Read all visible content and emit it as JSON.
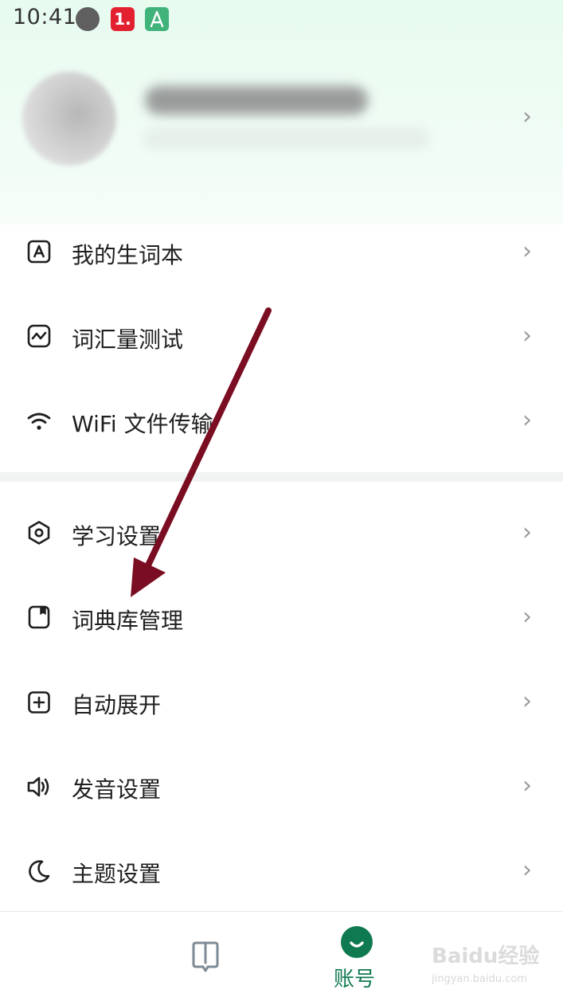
{
  "status_bar": {
    "time": "10:41",
    "badge_text": "1.",
    "icons": [
      "circle-icon",
      "badge-icon",
      "app-icon"
    ]
  },
  "profile": {
    "name": "",
    "chevron": "›"
  },
  "menu": {
    "group1": [
      {
        "label": "我的生词本",
        "icon": "wordbook-icon"
      },
      {
        "label": "词汇量测试",
        "icon": "chart-icon"
      },
      {
        "label": "WiFi 文件传输",
        "icon": "wifi-icon"
      }
    ],
    "group2": [
      {
        "label": "学习设置",
        "icon": "hexagon-settings-icon"
      },
      {
        "label": "词典库管理",
        "icon": "dictionary-icon"
      },
      {
        "label": "自动展开",
        "icon": "plus-square-icon"
      },
      {
        "label": "发音设置",
        "icon": "speaker-icon"
      },
      {
        "label": "主题设置",
        "icon": "moon-icon"
      }
    ],
    "chevron": "›"
  },
  "bottom_nav": {
    "items": [
      {
        "label": "",
        "icon": "book-icon"
      },
      {
        "label": "账号",
        "icon": "account-icon"
      }
    ]
  },
  "watermark": {
    "text": "Baidu经验",
    "sub": "jingyan.baidu.com"
  },
  "colors": {
    "accent": "#0f7a4f",
    "arrow": "#7a0d22",
    "header_bg": "#e7fbef"
  }
}
